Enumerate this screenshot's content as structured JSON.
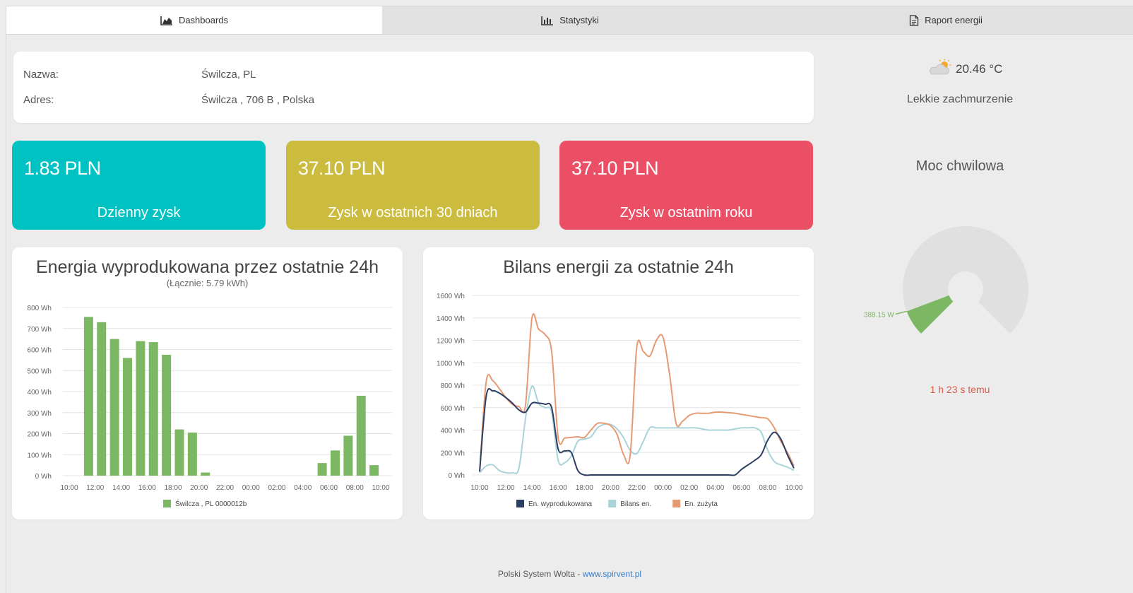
{
  "tabs": [
    {
      "label": "Dashboards",
      "icon": "area-chart-icon",
      "active": true
    },
    {
      "label": "Statystyki",
      "icon": "bar-chart-icon",
      "active": false
    },
    {
      "label": "Raport energii",
      "icon": "document-icon",
      "active": false
    }
  ],
  "info": {
    "name_label": "Nazwa:",
    "name_value": "Świlcza, PL",
    "address_label": "Adres:",
    "address_value": "Świlcza , 706 B , Polska"
  },
  "stats": [
    {
      "value": "1.83 PLN",
      "caption": "Dzienny zysk",
      "color": "#00c2c2"
    },
    {
      "value": "37.10 PLN",
      "caption": "Zysk w ostatnich 30 dniach",
      "color": "#cbbb3f"
    },
    {
      "value": "37.10 PLN",
      "caption": "Zysk w ostatnim roku",
      "color": "#ea4f66"
    }
  ],
  "weather": {
    "temperature": "20.46 °C",
    "condition": "Lekkie zachmurzenie",
    "icon": "partly-cloudy-icon"
  },
  "gauge": {
    "title": "Moc chwilowa",
    "value_label": "388.15 W",
    "fraction": 0.09,
    "fill_color": "#7cb863",
    "track_color": "#e0e0e0",
    "time_ago": "1 h 23 s temu"
  },
  "footer": {
    "text": "Polski System Wolta - ",
    "link": "www.spirvent.pl"
  },
  "chart_data": [
    {
      "type": "bar",
      "title": "Energia wyprodukowana przez ostatnie 24h",
      "subtitle": "(Łącznie: 5.79 kWh)",
      "ylim": [
        0,
        800
      ],
      "yticks": [
        "0 Wh",
        "100 Wh",
        "200 Wh",
        "300 Wh",
        "400 Wh",
        "500 Wh",
        "600 Wh",
        "700 Wh",
        "800 Wh"
      ],
      "xticks": [
        "10:00",
        "12:00",
        "14:00",
        "16:00",
        "18:00",
        "20:00",
        "22:00",
        "00:00",
        "02:00",
        "04:00",
        "06:00",
        "08:00",
        "10:00"
      ],
      "bar_hours": [
        11,
        12,
        13,
        14,
        15,
        16,
        17,
        18,
        19,
        20,
        5,
        6,
        7,
        8,
        9
      ],
      "values": [
        755,
        730,
        650,
        560,
        640,
        635,
        575,
        220,
        205,
        15,
        60,
        120,
        190,
        380,
        50
      ],
      "series": [
        {
          "name": "Świlcza , PL 0000012b",
          "color": "#7cb863"
        }
      ],
      "grid": true,
      "legend": "bottom"
    },
    {
      "type": "line",
      "title": "Bilans energii za ostatnie 24h",
      "ylim": [
        0,
        1600
      ],
      "yticks": [
        "0 Wh",
        "200 Wh",
        "400 Wh",
        "600 Wh",
        "800 Wh",
        "1000 Wh",
        "1200 Wh",
        "1400 Wh",
        "1600 Wh"
      ],
      "xticks": [
        "10:00",
        "12:00",
        "14:00",
        "16:00",
        "18:00",
        "20:00",
        "22:00",
        "00:00",
        "02:00",
        "04:00",
        "06:00",
        "08:00",
        "10:00"
      ],
      "x_hours_from_start": [
        0,
        0.5,
        1,
        1.5,
        2,
        2.5,
        3,
        3.5,
        4,
        4.5,
        5,
        5.5,
        6,
        6.5,
        7,
        7.5,
        8,
        8.5,
        9,
        9.5,
        10,
        10.5,
        11,
        11.5,
        12,
        12.5,
        13,
        13.5,
        14,
        14.5,
        15,
        15.5,
        16,
        16.5,
        17,
        17.5,
        18,
        18.5,
        19,
        19.5,
        20,
        20.5,
        21,
        21.5,
        22,
        22.5,
        23,
        23.5,
        24
      ],
      "series": [
        {
          "name": "En. wyprodukowana",
          "color": "#2d3e64",
          "values": [
            30,
            700,
            750,
            730,
            690,
            640,
            580,
            560,
            640,
            640,
            630,
            600,
            230,
            215,
            200,
            40,
            0,
            0,
            0,
            0,
            0,
            0,
            0,
            0,
            0,
            0,
            0,
            0,
            0,
            0,
            0,
            0,
            0,
            0,
            0,
            0,
            0,
            0,
            0,
            0,
            50,
            90,
            130,
            180,
            310,
            380,
            320,
            180,
            60
          ]
        },
        {
          "name": "Bilans en.",
          "color": "#a8d3d8",
          "values": [
            20,
            80,
            90,
            40,
            20,
            20,
            60,
            500,
            790,
            640,
            600,
            560,
            130,
            110,
            170,
            300,
            320,
            340,
            420,
            450,
            450,
            410,
            330,
            220,
            190,
            300,
            420,
            420,
            420,
            420,
            420,
            420,
            420,
            420,
            410,
            400,
            400,
            400,
            400,
            410,
            420,
            420,
            420,
            380,
            220,
            120,
            90,
            70,
            40
          ]
        },
        {
          "name": "En. zużyta",
          "color": "#e69a74",
          "values": [
            30,
            830,
            840,
            770,
            690,
            630,
            610,
            620,
            1400,
            1300,
            1250,
            1100,
            330,
            330,
            335,
            340,
            335,
            400,
            460,
            460,
            440,
            360,
            180,
            180,
            1140,
            1100,
            1060,
            1200,
            1230,
            900,
            460,
            480,
            530,
            550,
            550,
            550,
            560,
            560,
            555,
            550,
            540,
            530,
            520,
            510,
            500,
            420,
            300,
            200,
            80
          ]
        }
      ],
      "grid": true,
      "legend": "bottom"
    }
  ]
}
